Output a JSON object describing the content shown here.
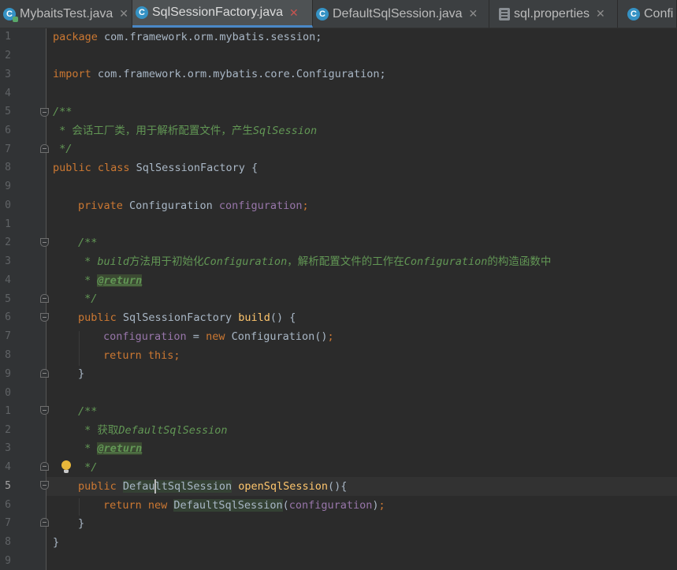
{
  "tabs": [
    {
      "label": "MybaitsTest.java",
      "icon": "java-test-class-icon",
      "active": false
    },
    {
      "label": "SqlSessionFactory.java",
      "icon": "java-class-icon",
      "active": true
    },
    {
      "label": "DefaultSqlSession.java",
      "icon": "java-class-icon",
      "active": false
    },
    {
      "label": "sql.properties",
      "icon": "properties-file-icon",
      "active": false
    },
    {
      "label": "Confi",
      "icon": "java-class-icon",
      "active": false
    }
  ],
  "gutter": {
    "line_numbers": [
      "1",
      "2",
      "3",
      "4",
      "5",
      "6",
      "7",
      "8",
      "9",
      "0",
      "1",
      "2",
      "3",
      "4",
      "5",
      "6",
      "7",
      "8",
      "9",
      "0",
      "1",
      "2",
      "3",
      "4",
      "5",
      "6",
      "7",
      "8",
      "9"
    ],
    "current_line": "5"
  },
  "code": {
    "l1": {
      "kw": "package",
      "rest": " com.framework.orm.mybatis.session;"
    },
    "l3": {
      "kw": "import",
      "rest": " com.framework.orm.mybatis.core.Configuration;"
    },
    "l5": "/**",
    "l6": {
      "a": " * 会话工厂类，用于解析配置文件，产生",
      "b": "SqlSession"
    },
    "l7": " */",
    "l8": {
      "kw": "public class",
      "rest": " SqlSessionFactory {"
    },
    "l10": {
      "kw": "private",
      "type": " Configuration ",
      "field": "configuration",
      "semi": ";"
    },
    "l12": "/**",
    "l13": {
      "a": " * ",
      "b": "build",
      "c": "方法用于初始化",
      "d": "Configuration",
      "e": "，解析配置文件的工作在",
      "f": "Configuration",
      "g": "的构造函数中"
    },
    "l14": {
      "a": " * ",
      "tag": "@return"
    },
    "l15": " */",
    "l16": {
      "kw": "public",
      "type": " SqlSessionFactory ",
      "method": "build",
      "rest": "() {"
    },
    "l17": {
      "field": "configuration",
      "op": " = ",
      "kw": "new",
      "rest": " Configuration()",
      "semi": ";"
    },
    "l18": {
      "kw": "return this",
      "semi": ";"
    },
    "l19": "}",
    "l21": "/**",
    "l22": {
      "a": " * 获取",
      "b": "DefaultSqlSession"
    },
    "l23": {
      "a": " * ",
      "tag": "@return"
    },
    "l24": " */",
    "l25": {
      "kw": "public",
      "sp": " ",
      "type_a": "Defau",
      "type_b": "ltSqlSession",
      "sp2": " ",
      "method": "openSqlSession",
      "rest": "(){"
    },
    "l26": {
      "kw": "return new",
      "sp": " ",
      "type": "DefaultSqlSession",
      "paren": "(",
      "field": "configuration",
      "close": ")",
      "semi": ";"
    },
    "l27": "}",
    "l28": "}"
  },
  "colors": {
    "background": "#2b2b2b",
    "keyword": "#cc7832",
    "doc_comment": "#629755",
    "field": "#9876aa",
    "method": "#ffc66d",
    "text": "#a9b7c6",
    "active_tab_underline": "#4a88c7"
  }
}
